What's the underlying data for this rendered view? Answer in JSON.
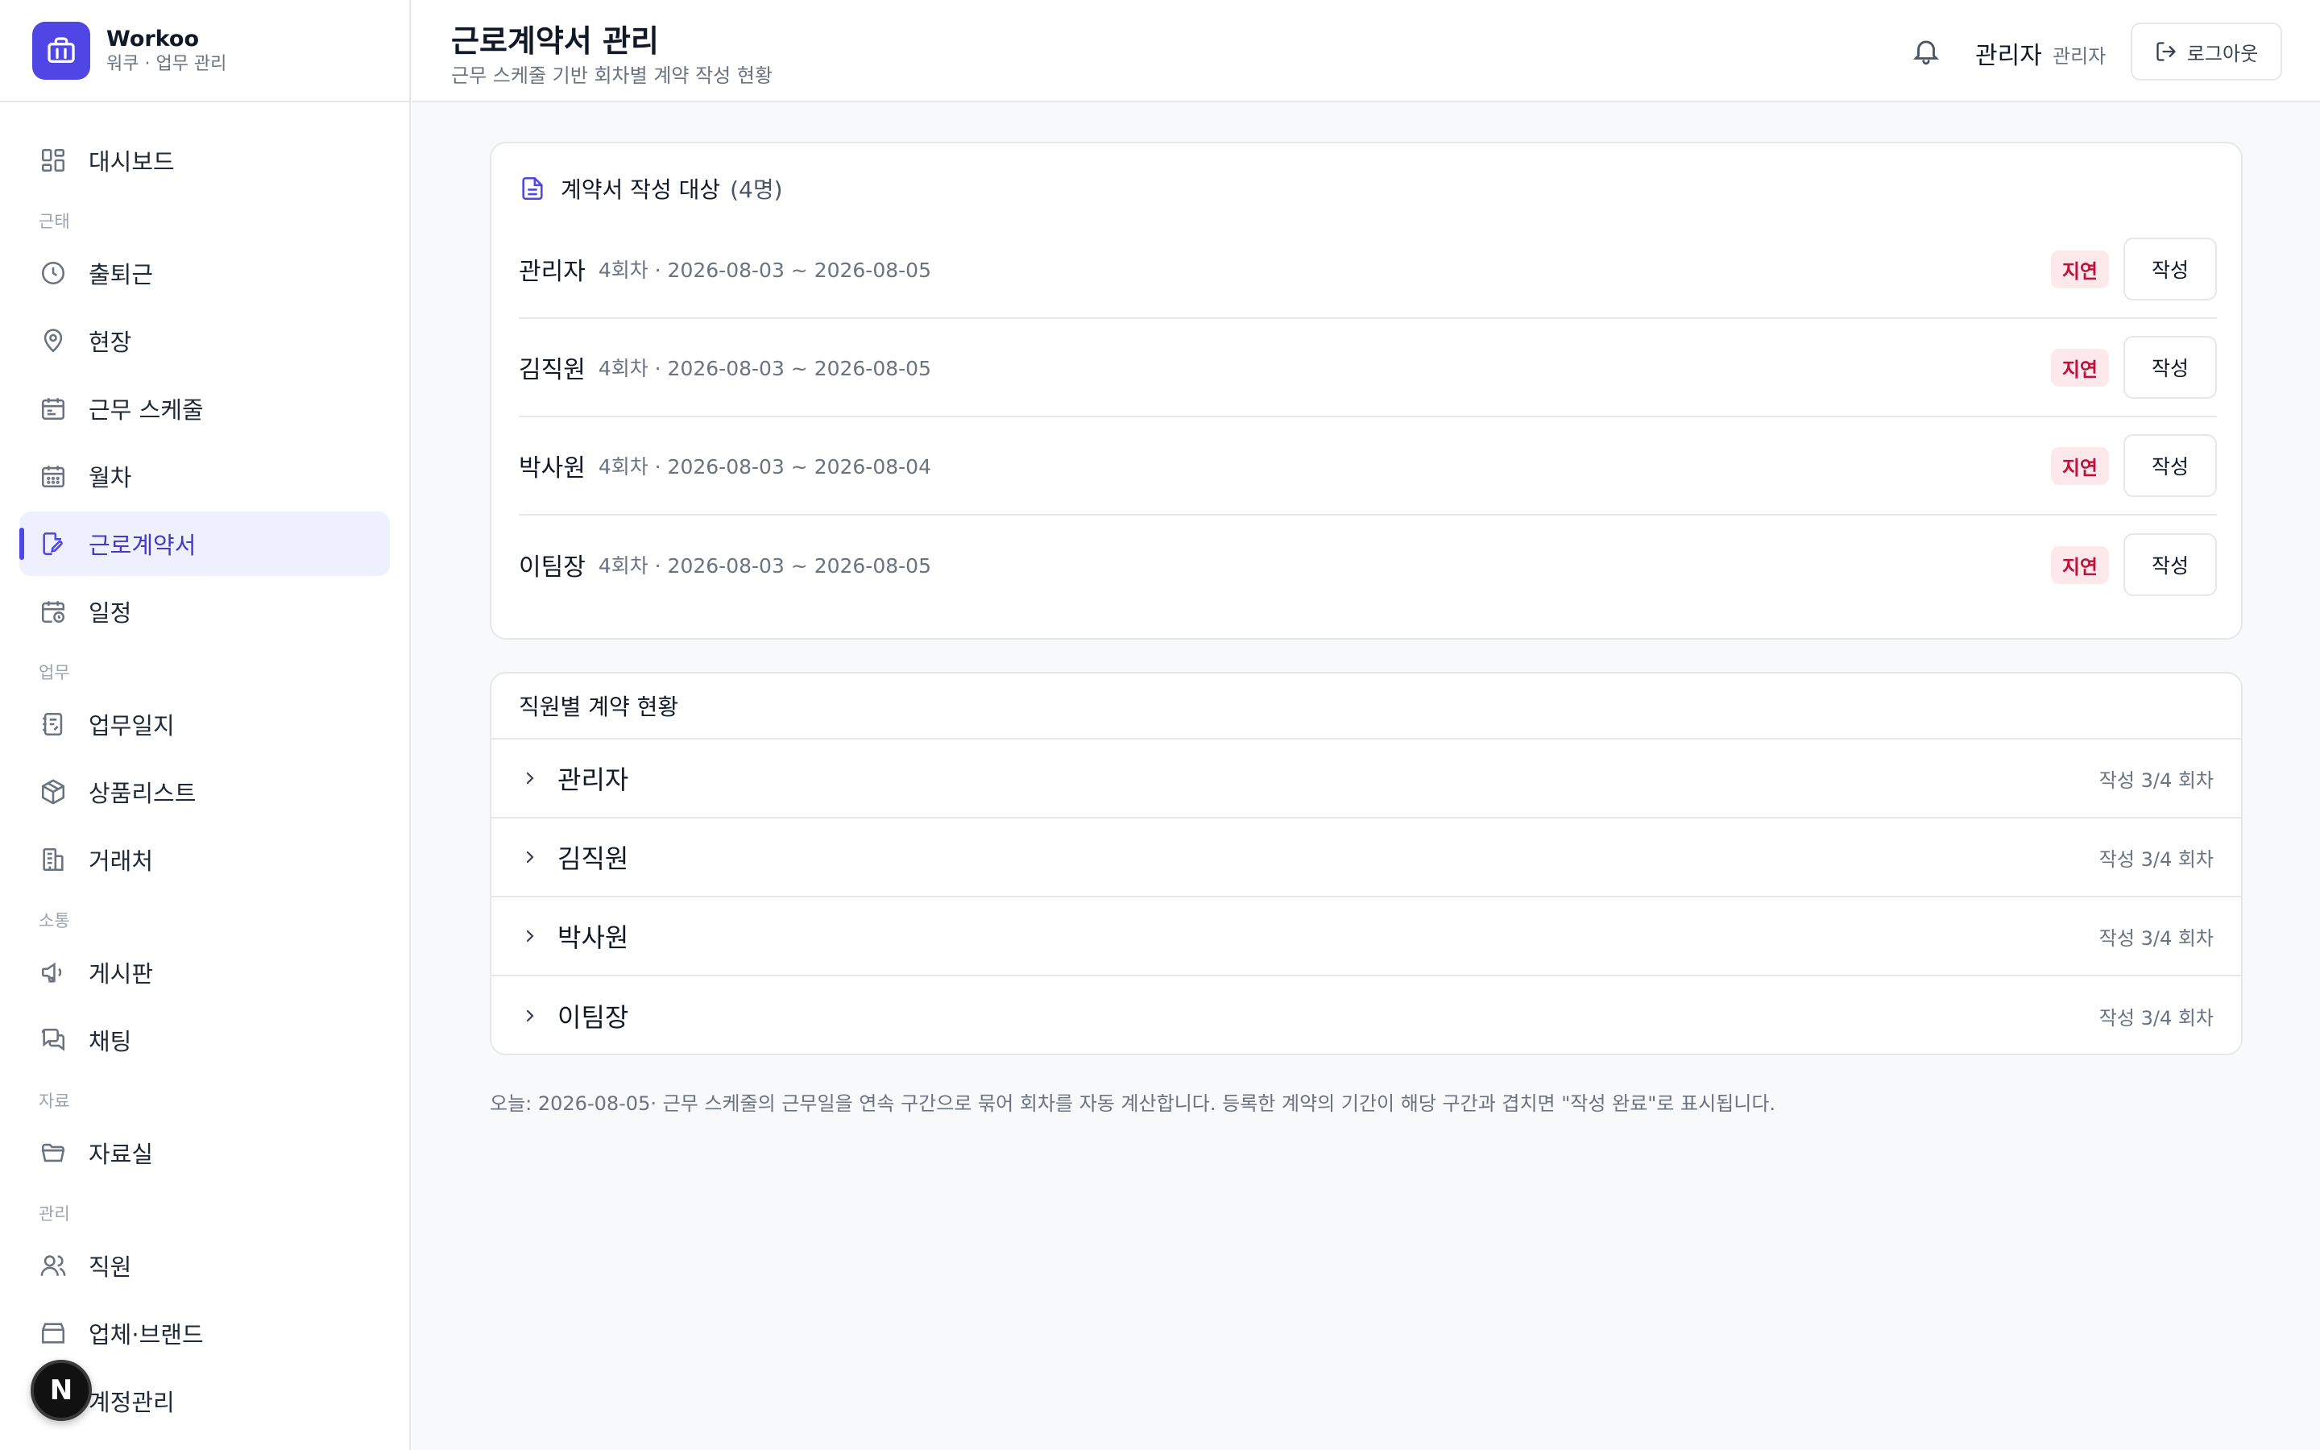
{
  "brand": {
    "name": "Workoo",
    "sub": "워쿠 · 업무 관리"
  },
  "sidebar": {
    "groups": [
      {
        "label": "",
        "items": [
          {
            "label": "대시보드",
            "icon": "dashboard-icon"
          }
        ]
      },
      {
        "label": "근태",
        "items": [
          {
            "label": "출퇴근",
            "icon": "clock-icon"
          },
          {
            "label": "현장",
            "icon": "map-pin-icon"
          },
          {
            "label": "근무 스케줄",
            "icon": "calendar-icon"
          },
          {
            "label": "월차",
            "icon": "calendar-grid-icon"
          },
          {
            "label": "근로계약서",
            "icon": "edit-document-icon",
            "active": true
          },
          {
            "label": "일정",
            "icon": "calendar-clock-icon"
          }
        ]
      },
      {
        "label": "업무",
        "items": [
          {
            "label": "업무일지",
            "icon": "notebook-icon"
          },
          {
            "label": "상품리스트",
            "icon": "package-icon"
          },
          {
            "label": "거래처",
            "icon": "building-icon"
          }
        ]
      },
      {
        "label": "소통",
        "items": [
          {
            "label": "게시판",
            "icon": "megaphone-icon"
          },
          {
            "label": "채팅",
            "icon": "chat-icon"
          }
        ]
      },
      {
        "label": "자료",
        "items": [
          {
            "label": "자료실",
            "icon": "folder-icon"
          }
        ]
      },
      {
        "label": "관리",
        "items": [
          {
            "label": "직원",
            "icon": "users-icon"
          },
          {
            "label": "업체·브랜드",
            "icon": "store-icon"
          },
          {
            "label": "계정관리",
            "icon": "key-icon"
          }
        ]
      }
    ],
    "fab_label": "N"
  },
  "header": {
    "title": "근로계약서 관리",
    "subtitle": "근무 스케줄 기반 회차별 계약 작성 현황",
    "user_name": "관리자",
    "user_role": "관리자",
    "logout_label": "로그아웃"
  },
  "targets": {
    "title": "계약서 작성 대상",
    "count": "(4명)",
    "rows": [
      {
        "name": "관리자",
        "meta": "4회차 · 2026-08-03 ~ 2026-08-05",
        "badge": "지연",
        "button": "작성"
      },
      {
        "name": "김직원",
        "meta": "4회차 · 2026-08-03 ~ 2026-08-05",
        "badge": "지연",
        "button": "작성"
      },
      {
        "name": "박사원",
        "meta": "4회차 · 2026-08-03 ~ 2026-08-04",
        "badge": "지연",
        "button": "작성"
      },
      {
        "name": "이팀장",
        "meta": "4회차 · 2026-08-03 ~ 2026-08-05",
        "badge": "지연",
        "button": "작성"
      }
    ]
  },
  "status": {
    "title": "직원별 계약 현황",
    "rows": [
      {
        "name": "관리자",
        "progress": "작성 3/4 회차"
      },
      {
        "name": "김직원",
        "progress": "작성 3/4 회차"
      },
      {
        "name": "박사원",
        "progress": "작성 3/4 회차"
      },
      {
        "name": "이팀장",
        "progress": "작성 3/4 회차"
      }
    ]
  },
  "footnote": "오늘: 2026-08-05· 근무 스케줄의 근무일을 연속 구간으로 묶어 회차를 자동 계산합니다. 등록한 계약의 기간이 해당 구간과 겹치면 \"작성 완료\"로 표시됩니다.",
  "colors": {
    "accent": "#4f46e5",
    "late_badge_bg": "#fde8ec",
    "late_badge_text": "#be123c"
  }
}
